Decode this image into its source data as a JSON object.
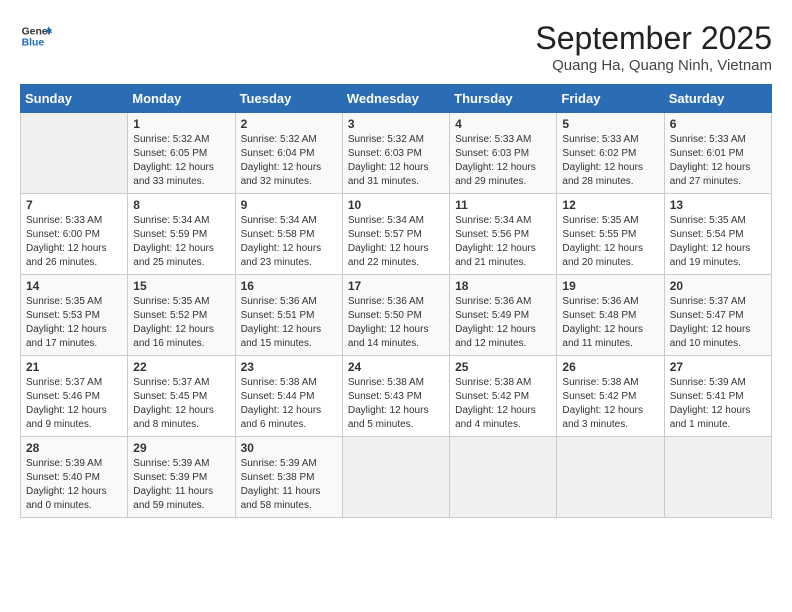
{
  "logo": {
    "line1": "General",
    "line2": "Blue"
  },
  "title": "September 2025",
  "subtitle": "Quang Ha, Quang Ninh, Vietnam",
  "weekdays": [
    "Sunday",
    "Monday",
    "Tuesday",
    "Wednesday",
    "Thursday",
    "Friday",
    "Saturday"
  ],
  "weeks": [
    [
      {
        "day": "",
        "content": ""
      },
      {
        "day": "1",
        "content": "Sunrise: 5:32 AM\nSunset: 6:05 PM\nDaylight: 12 hours\nand 33 minutes."
      },
      {
        "day": "2",
        "content": "Sunrise: 5:32 AM\nSunset: 6:04 PM\nDaylight: 12 hours\nand 32 minutes."
      },
      {
        "day": "3",
        "content": "Sunrise: 5:32 AM\nSunset: 6:03 PM\nDaylight: 12 hours\nand 31 minutes."
      },
      {
        "day": "4",
        "content": "Sunrise: 5:33 AM\nSunset: 6:03 PM\nDaylight: 12 hours\nand 29 minutes."
      },
      {
        "day": "5",
        "content": "Sunrise: 5:33 AM\nSunset: 6:02 PM\nDaylight: 12 hours\nand 28 minutes."
      },
      {
        "day": "6",
        "content": "Sunrise: 5:33 AM\nSunset: 6:01 PM\nDaylight: 12 hours\nand 27 minutes."
      }
    ],
    [
      {
        "day": "7",
        "content": "Sunrise: 5:33 AM\nSunset: 6:00 PM\nDaylight: 12 hours\nand 26 minutes."
      },
      {
        "day": "8",
        "content": "Sunrise: 5:34 AM\nSunset: 5:59 PM\nDaylight: 12 hours\nand 25 minutes."
      },
      {
        "day": "9",
        "content": "Sunrise: 5:34 AM\nSunset: 5:58 PM\nDaylight: 12 hours\nand 23 minutes."
      },
      {
        "day": "10",
        "content": "Sunrise: 5:34 AM\nSunset: 5:57 PM\nDaylight: 12 hours\nand 22 minutes."
      },
      {
        "day": "11",
        "content": "Sunrise: 5:34 AM\nSunset: 5:56 PM\nDaylight: 12 hours\nand 21 minutes."
      },
      {
        "day": "12",
        "content": "Sunrise: 5:35 AM\nSunset: 5:55 PM\nDaylight: 12 hours\nand 20 minutes."
      },
      {
        "day": "13",
        "content": "Sunrise: 5:35 AM\nSunset: 5:54 PM\nDaylight: 12 hours\nand 19 minutes."
      }
    ],
    [
      {
        "day": "14",
        "content": "Sunrise: 5:35 AM\nSunset: 5:53 PM\nDaylight: 12 hours\nand 17 minutes."
      },
      {
        "day": "15",
        "content": "Sunrise: 5:35 AM\nSunset: 5:52 PM\nDaylight: 12 hours\nand 16 minutes."
      },
      {
        "day": "16",
        "content": "Sunrise: 5:36 AM\nSunset: 5:51 PM\nDaylight: 12 hours\nand 15 minutes."
      },
      {
        "day": "17",
        "content": "Sunrise: 5:36 AM\nSunset: 5:50 PM\nDaylight: 12 hours\nand 14 minutes."
      },
      {
        "day": "18",
        "content": "Sunrise: 5:36 AM\nSunset: 5:49 PM\nDaylight: 12 hours\nand 12 minutes."
      },
      {
        "day": "19",
        "content": "Sunrise: 5:36 AM\nSunset: 5:48 PM\nDaylight: 12 hours\nand 11 minutes."
      },
      {
        "day": "20",
        "content": "Sunrise: 5:37 AM\nSunset: 5:47 PM\nDaylight: 12 hours\nand 10 minutes."
      }
    ],
    [
      {
        "day": "21",
        "content": "Sunrise: 5:37 AM\nSunset: 5:46 PM\nDaylight: 12 hours\nand 9 minutes."
      },
      {
        "day": "22",
        "content": "Sunrise: 5:37 AM\nSunset: 5:45 PM\nDaylight: 12 hours\nand 8 minutes."
      },
      {
        "day": "23",
        "content": "Sunrise: 5:38 AM\nSunset: 5:44 PM\nDaylight: 12 hours\nand 6 minutes."
      },
      {
        "day": "24",
        "content": "Sunrise: 5:38 AM\nSunset: 5:43 PM\nDaylight: 12 hours\nand 5 minutes."
      },
      {
        "day": "25",
        "content": "Sunrise: 5:38 AM\nSunset: 5:42 PM\nDaylight: 12 hours\nand 4 minutes."
      },
      {
        "day": "26",
        "content": "Sunrise: 5:38 AM\nSunset: 5:42 PM\nDaylight: 12 hours\nand 3 minutes."
      },
      {
        "day": "27",
        "content": "Sunrise: 5:39 AM\nSunset: 5:41 PM\nDaylight: 12 hours\nand 1 minute."
      }
    ],
    [
      {
        "day": "28",
        "content": "Sunrise: 5:39 AM\nSunset: 5:40 PM\nDaylight: 12 hours\nand 0 minutes."
      },
      {
        "day": "29",
        "content": "Sunrise: 5:39 AM\nSunset: 5:39 PM\nDaylight: 11 hours\nand 59 minutes."
      },
      {
        "day": "30",
        "content": "Sunrise: 5:39 AM\nSunset: 5:38 PM\nDaylight: 11 hours\nand 58 minutes."
      },
      {
        "day": "",
        "content": ""
      },
      {
        "day": "",
        "content": ""
      },
      {
        "day": "",
        "content": ""
      },
      {
        "day": "",
        "content": ""
      }
    ]
  ]
}
